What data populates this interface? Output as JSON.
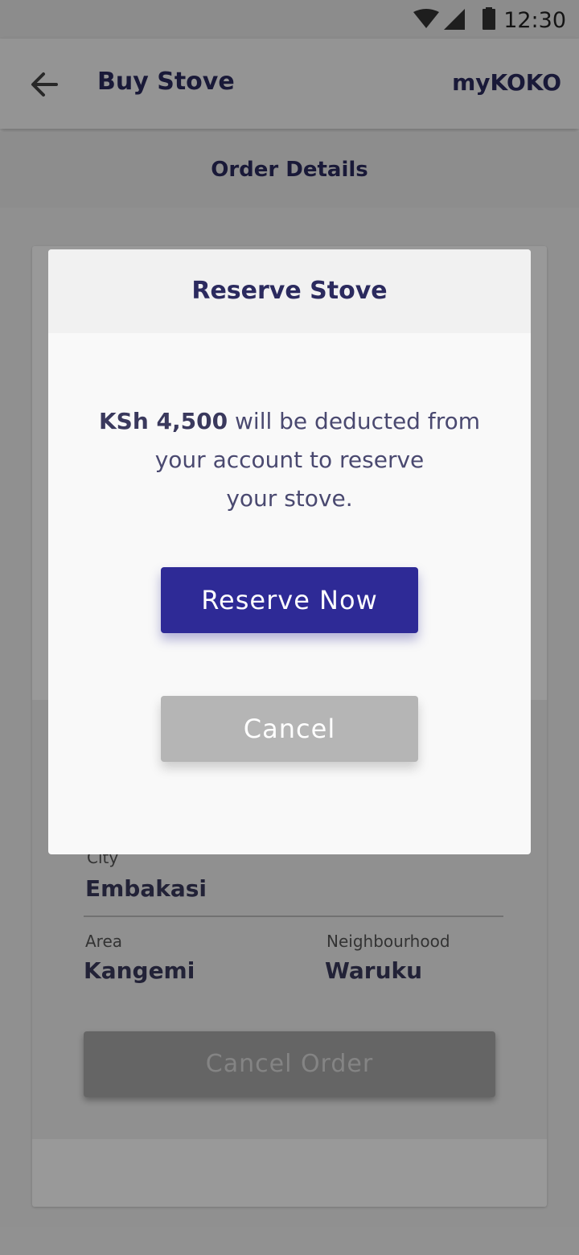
{
  "status_bar": {
    "time": "12:30",
    "icons": [
      "wifi-icon",
      "signal-icon",
      "battery-icon"
    ]
  },
  "app_bar": {
    "title": "Buy Stove",
    "brand": "myKOKO"
  },
  "subheader": {
    "title": "Order Details"
  },
  "order": {
    "city_label": "City",
    "city": "Embakasi",
    "area_label": "Area",
    "area": "Kangemi",
    "neighbourhood_label": "Neighbourhood",
    "neighbourhood": "Waruku",
    "cancel_order_label": "Cancel Order"
  },
  "dialog": {
    "title": "Reserve Stove",
    "amount": "KSh 4,500",
    "message_line1": " will be deducted from",
    "message_line2": "your account to reserve",
    "message_line3": "your stove.",
    "reserve_label": "Reserve Now",
    "cancel_label": "Cancel"
  },
  "colors": {
    "primary": "#2e2a96",
    "text_dark": "#2b2a5e",
    "cancel_button": "#b5b5b5"
  }
}
